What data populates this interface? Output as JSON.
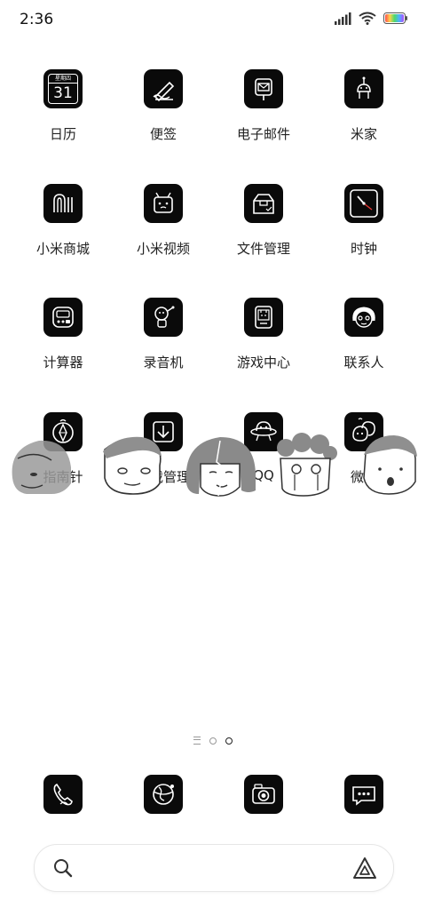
{
  "status_bar": {
    "time": "2:36",
    "icons": [
      "signal-icon",
      "wifi-icon",
      "battery-icon"
    ]
  },
  "apps": [
    {
      "label": "日历",
      "icon": "calendar-icon",
      "calendar_weekday": "星期四",
      "calendar_day": "31"
    },
    {
      "label": "便签",
      "icon": "notes-icon"
    },
    {
      "label": "电子邮件",
      "icon": "mail-icon"
    },
    {
      "label": "米家",
      "icon": "mijia-icon"
    },
    {
      "label": "小米商城",
      "icon": "mi-store-icon"
    },
    {
      "label": "小米视频",
      "icon": "video-icon"
    },
    {
      "label": "文件管理",
      "icon": "file-manager-icon"
    },
    {
      "label": "时钟",
      "icon": "clock-icon"
    },
    {
      "label": "计算器",
      "icon": "calculator-icon"
    },
    {
      "label": "录音机",
      "icon": "recorder-icon"
    },
    {
      "label": "游戏中心",
      "icon": "game-center-icon"
    },
    {
      "label": "联系人",
      "icon": "contacts-icon"
    },
    {
      "label": "指南针",
      "icon": "compass-icon"
    },
    {
      "label": "下载管理",
      "icon": "download-icon"
    },
    {
      "label": "QQ",
      "icon": "qq-icon"
    },
    {
      "label": "微信",
      "icon": "wechat-icon"
    }
  ],
  "page_indicator": {
    "items": [
      "list",
      "page-1",
      "page-2"
    ],
    "active": "page-2"
  },
  "dock": [
    {
      "icon": "phone-icon"
    },
    {
      "icon": "browser-icon"
    },
    {
      "icon": "camera-icon"
    },
    {
      "icon": "messages-icon"
    }
  ],
  "search": {
    "left_icon": "search-icon",
    "right_icon": "assistant-icon"
  }
}
